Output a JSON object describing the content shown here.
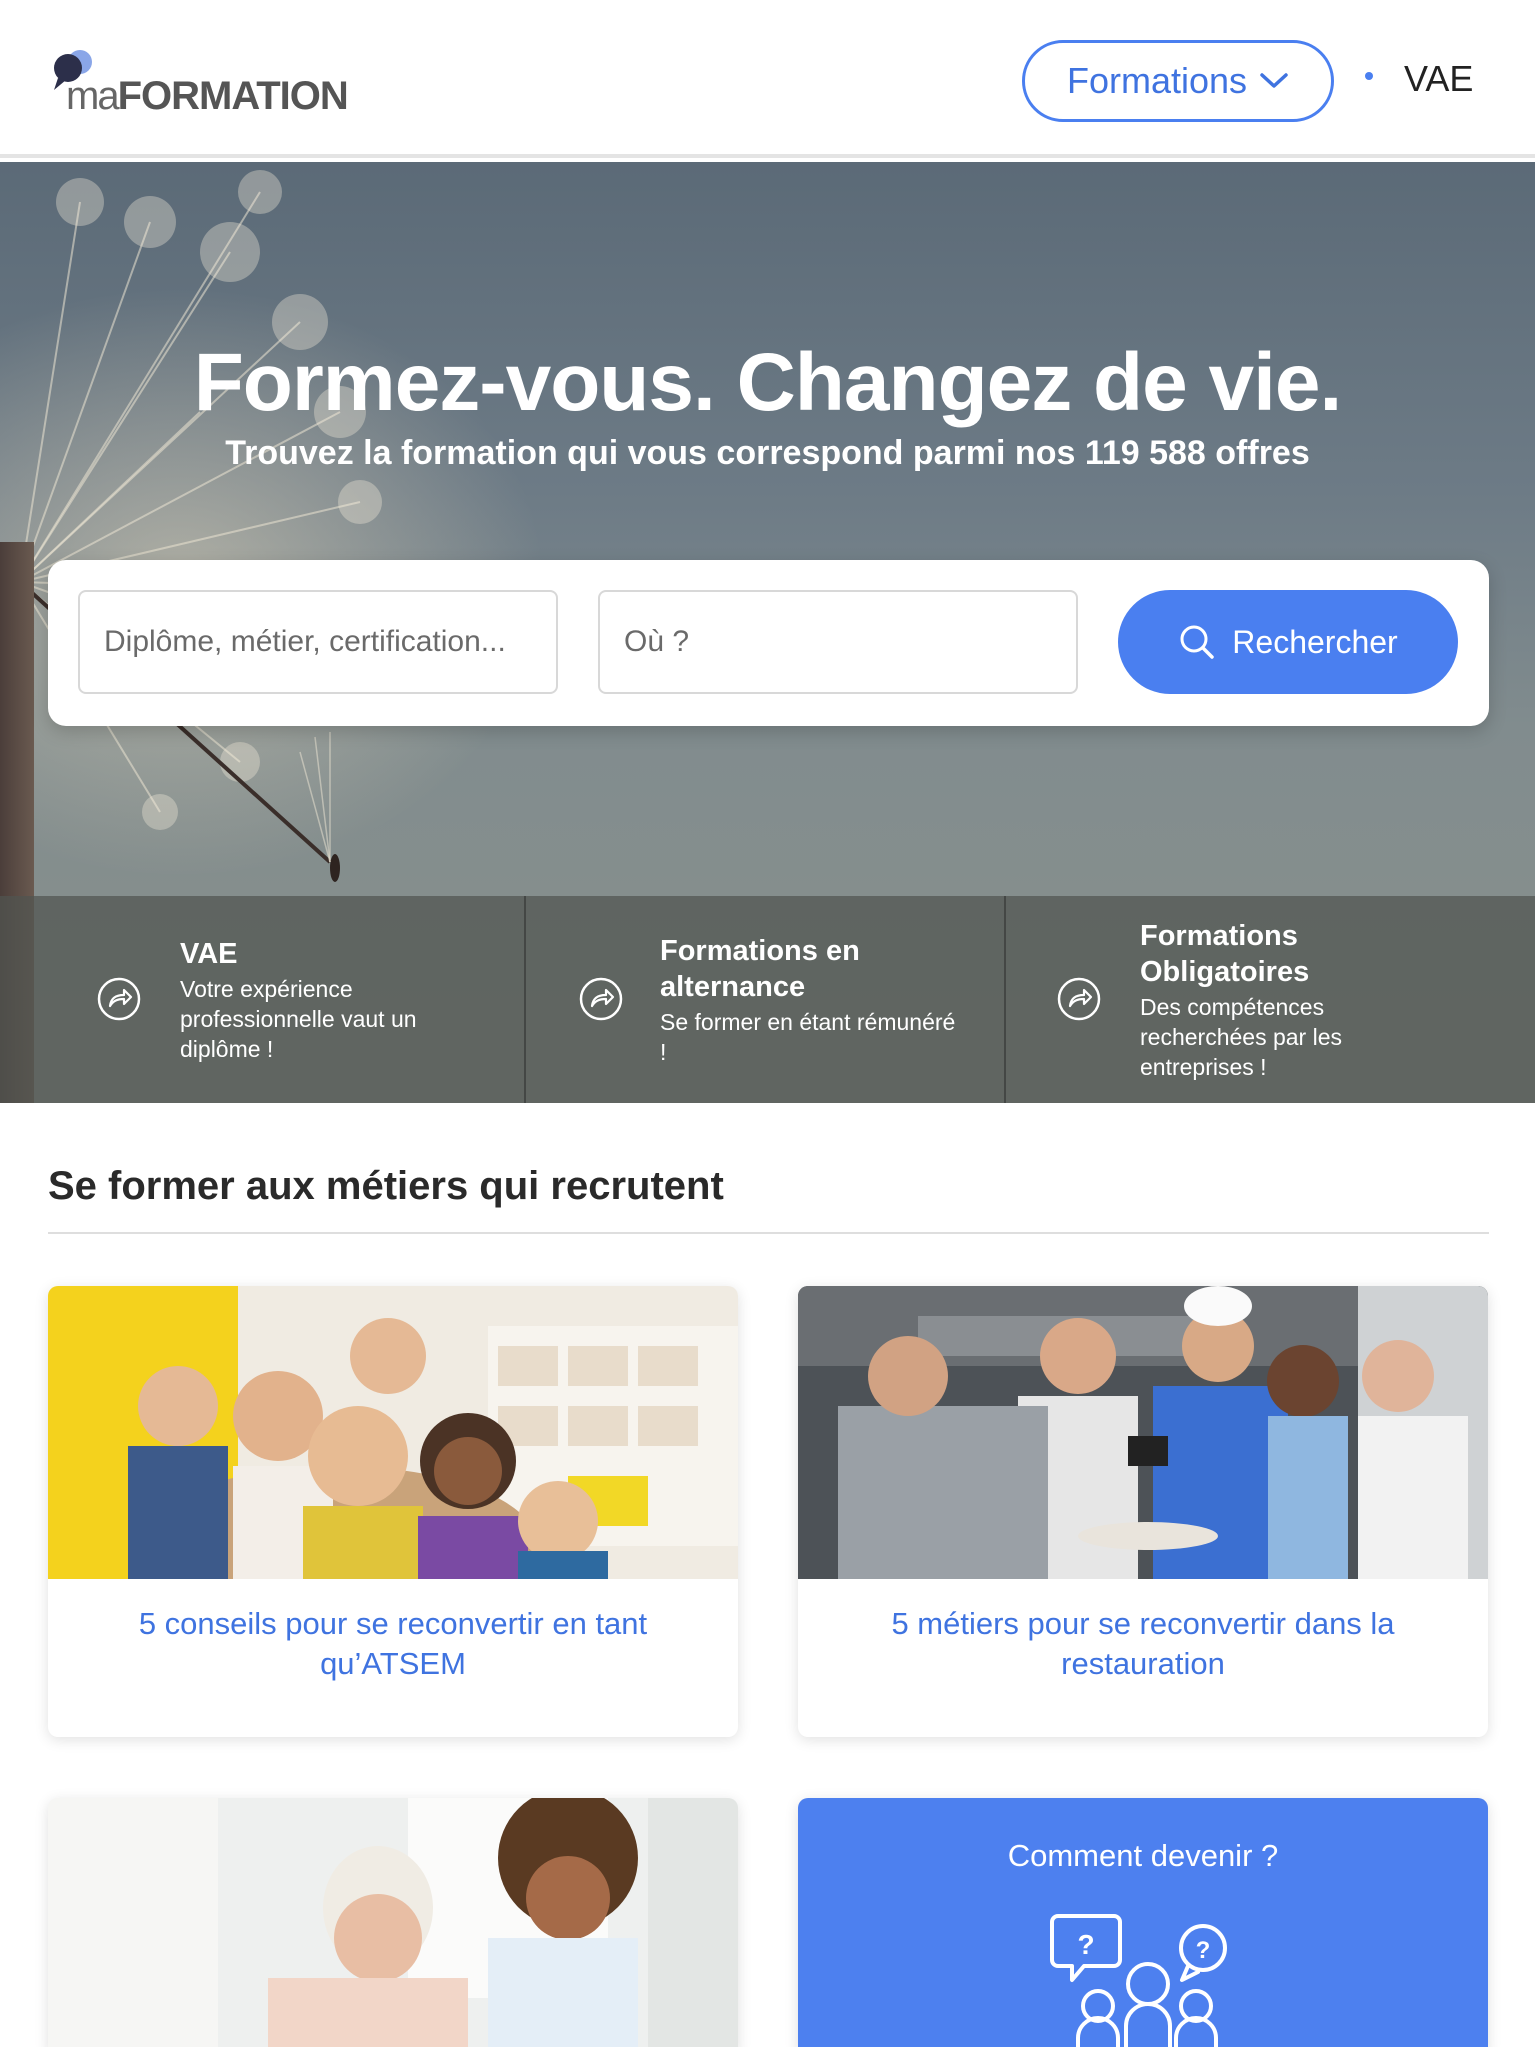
{
  "header": {
    "logo_prefix": "ma",
    "logo_main": "FORMATION",
    "nav": {
      "formations_label": "Formations",
      "vae_label": "VAE"
    }
  },
  "hero": {
    "title": "Formez-vous. Changez de vie.",
    "subtitle": "Trouvez la formation qui vous correspond parmi nos 119 588 offres",
    "search": {
      "what_placeholder": "Diplôme, métier, certification...",
      "where_placeholder": "Où ?",
      "button_label": "Rechercher"
    },
    "quick_links": [
      {
        "title": "VAE",
        "description": "Votre expérience professionnelle vaut un diplôme !"
      },
      {
        "title": "Formations en alternance",
        "description": "Se former en étant rémunéré !"
      },
      {
        "title": "Formations Obligatoires",
        "description": "Des compétences recherchées par les entreprises !"
      }
    ]
  },
  "section": {
    "title": "Se former aux métiers qui recrutent",
    "cards": [
      {
        "title": "5 conseils pour se reconvertir en tant qu’ATSEM"
      },
      {
        "title": "5 métiers pour se reconvertir dans la restauration"
      }
    ],
    "how_to_card": {
      "title": "Comment devenir ?"
    }
  },
  "colors": {
    "accent": "#4a7ff0",
    "link": "#3f73e0"
  }
}
